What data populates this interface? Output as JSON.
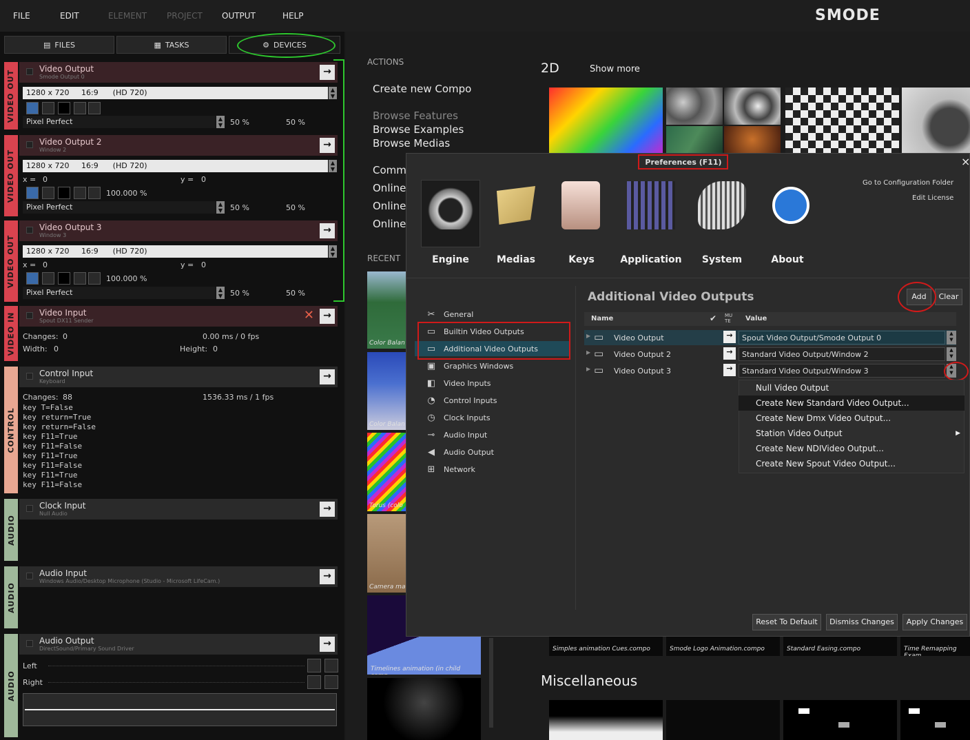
{
  "menubar": {
    "items": [
      "FILE",
      "EDIT",
      "ELEMENT",
      "PROJECT",
      "OUTPUT",
      "HELP"
    ],
    "logo": "SMODE"
  },
  "tabs": {
    "files": "FILES",
    "tasks": "TASKS",
    "devices": "DEVICES"
  },
  "side_labels": {
    "video_out": "VIDEO OUT",
    "video_in": "VIDEO IN",
    "control": "CONTROL",
    "audio": "AUDIO"
  },
  "devices": {
    "vo1": {
      "title": "Video Output",
      "sub": "Smode Output 0",
      "res": "1280 x 720",
      "ratio": "16:9",
      "mode": "(HD 720)",
      "fit": "Pixel Perfect",
      "pct_a": "50 %",
      "pct_b": "50 %"
    },
    "vo2": {
      "title": "Video Output 2",
      "sub": "Window 2",
      "res": "1280 x 720",
      "ratio": "16:9",
      "mode": "(HD 720)",
      "x_label": "x =",
      "x": "0",
      "y_label": "y =",
      "y": "0",
      "scale": "100.000 %",
      "fit": "Pixel Perfect",
      "pct_a": "50 %",
      "pct_b": "50 %"
    },
    "vo3": {
      "title": "Video Output 3",
      "sub": "Window 3",
      "res": "1280 x 720",
      "ratio": "16:9",
      "mode": "(HD 720)",
      "x_label": "x =",
      "x": "0",
      "y_label": "y =",
      "y": "0",
      "scale": "100.000 %",
      "fit": "Pixel Perfect",
      "pct_a": "50 %",
      "pct_b": "50 %"
    },
    "vin": {
      "title": "Video Input",
      "sub": "Spout DX11 Sender",
      "changes_label": "Changes:",
      "changes": "0",
      "timing": "0.00 ms / 0 fps",
      "width_label": "Width:",
      "width": "0",
      "height_label": "Height:",
      "height": "0"
    },
    "ctrl": {
      "title": "Control Input",
      "sub": "Keyboard",
      "changes_label": "Changes:",
      "changes": "88",
      "timing": "1536.33 ms / 1 fps",
      "log": [
        "key T=False",
        "key return=True",
        "key return=False",
        "key F11=True",
        "key F11=False",
        "key F11=True",
        "key F11=False",
        "key F11=True",
        "key F11=False"
      ]
    },
    "clock": {
      "title": "Clock Input",
      "sub": "Null Audio"
    },
    "ain": {
      "title": "Audio Input",
      "sub": "Windows Audio/Desktop Microphone (Studio - Microsoft LifeCam.)"
    },
    "aout": {
      "title": "Audio Output",
      "sub": "DirectSound/Primary Sound Driver",
      "left": "Left",
      "right": "Right"
    }
  },
  "main": {
    "actions_label": "ACTIONS",
    "recent_label": "RECENT",
    "create": "Create new Compo",
    "browse_features": "Browse Features",
    "browse_examples": "Browse Examples",
    "browse_medias": "Browse Medias",
    "comm": "Comm",
    "online1": "Online",
    "online2": "Online",
    "online3": "Online",
    "section_2d": "2D",
    "show_more": "Show more",
    "misc": "Miscellaneous",
    "captions": [
      "Color Balan",
      "Color Balan",
      "Torus (colo",
      "Camera ma",
      "Timelines animation (in child comp..."
    ],
    "compo_captions": [
      "Simples animation Cues.compo",
      "Smode Logo Animation.compo",
      "Standard Easing.compo",
      "Time Remapping Exam"
    ]
  },
  "dialog": {
    "title": "Preferences (F11)",
    "close": "×",
    "go_config": "Go to Configuration Folder",
    "edit_license": "Edit License",
    "categories": [
      "Engine",
      "Medias",
      "Keys",
      "Application",
      "System",
      "About"
    ],
    "tree": [
      "General",
      "Builtin Video Outputs",
      "Additional Video Outputs",
      "Graphics Windows",
      "Video Inputs",
      "Control Inputs",
      "Clock Inputs",
      "Audio Input",
      "Audio Output",
      "Network"
    ],
    "section_title": "Additional Video Outputs",
    "add": "Add",
    "clear": "Clear",
    "col_name": "Name",
    "col_mute": "MU TE",
    "col_value": "Value",
    "rows": [
      {
        "name": "Video Output",
        "value": "Spout Video Output/Smode Output 0"
      },
      {
        "name": "Video Output 2",
        "value": "Standard Video Output/Window 2"
      },
      {
        "name": "Video Output 3",
        "value": "Standard Video Output/Window 3"
      }
    ],
    "dropdown": [
      "Null Video Output",
      "Create New Standard Video Output...",
      "Create New Dmx Video Output...",
      "Station Video Output",
      "Create New NDIVideo Output...",
      "Create New Spout Video Output..."
    ],
    "reset": "Reset To Default",
    "dismiss": "Dismiss Changes",
    "apply": "Apply Changes"
  },
  "colors": {
    "accent_red": "#d01a1a",
    "accent_green": "#2ec82e",
    "video_out": "#d9434f",
    "video_in": "#d9434f",
    "control": "#e8a792",
    "audio": "#9fb89a"
  }
}
